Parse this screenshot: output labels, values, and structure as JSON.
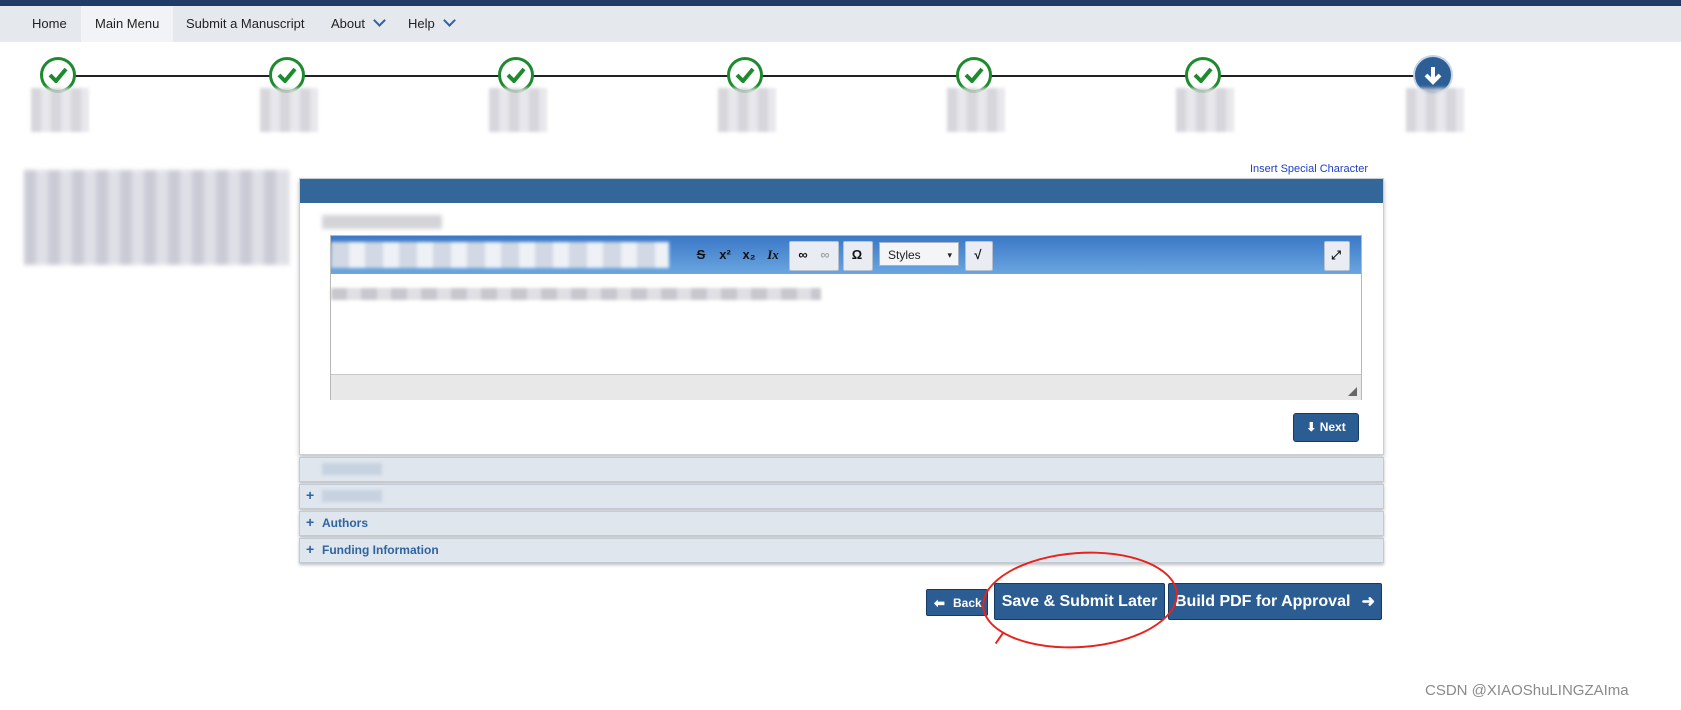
{
  "nav": {
    "items": [
      {
        "label": "Home"
      },
      {
        "label": "Main Menu"
      },
      {
        "label": "Submit a Manuscript"
      },
      {
        "label": "About"
      },
      {
        "label": "Help"
      }
    ]
  },
  "progress": {
    "completed_steps": 6,
    "total_steps": 7,
    "current_step": 7
  },
  "editor": {
    "insert_special_character": "Insert Special Character",
    "toolbar": {
      "strikethrough": "S",
      "superscript": "x²",
      "subscript": "x₂",
      "remove_format": "Ix",
      "special_char": "Ω",
      "styles_label": "Styles",
      "math": "√"
    },
    "next_label": "Next"
  },
  "sections": [
    {
      "label": ""
    },
    {
      "label": ""
    },
    {
      "label": "Authors"
    },
    {
      "label": "Funding Information"
    }
  ],
  "actions": {
    "back_label": "Back",
    "save_label": "Save & Submit Later",
    "pdf_label": "Build PDF for Approval"
  },
  "colors": {
    "accent": "#2b5c92",
    "check": "#1e8a2e",
    "annotation": "#e8231a"
  },
  "watermark": "CSDN @XIAOShuLINGZAIma"
}
